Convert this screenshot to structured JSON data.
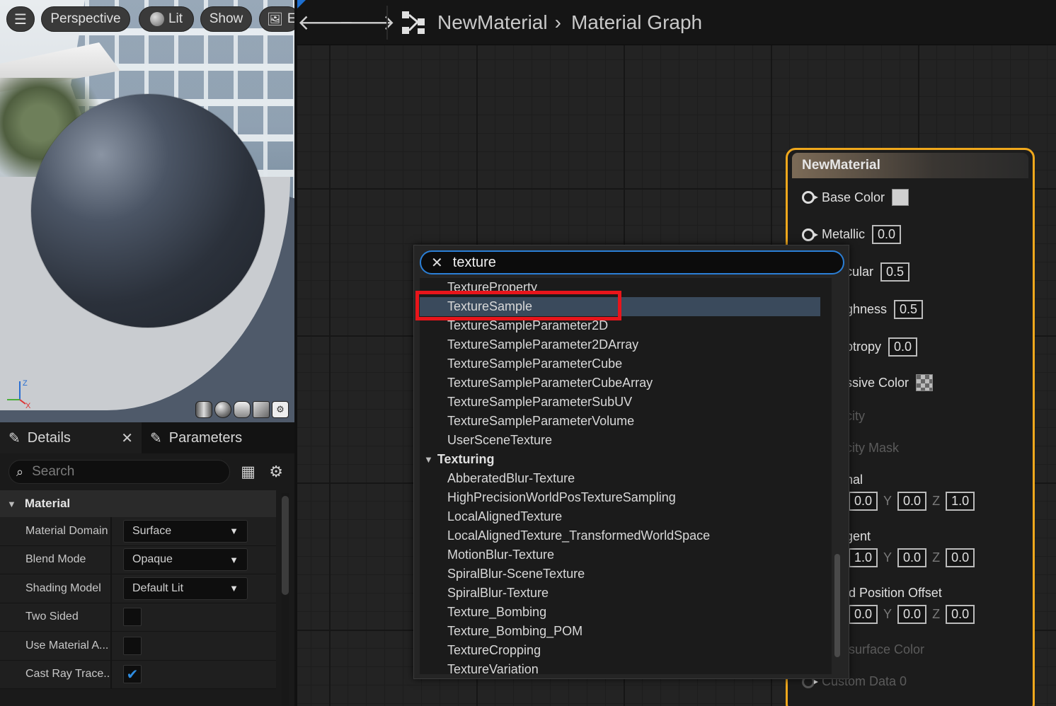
{
  "viewport": {
    "buttons": {
      "perspective": "Perspective",
      "lit": "Lit",
      "show": "Show",
      "image_partial": "E"
    },
    "axis": {
      "z": "Z",
      "x": "X"
    }
  },
  "details": {
    "tabs": {
      "details": "Details",
      "parameters": "Parameters"
    },
    "search_placeholder": "Search",
    "category": "Material",
    "rows": [
      {
        "label": "Material Domain",
        "value": "Surface",
        "type": "dropdown"
      },
      {
        "label": "Blend Mode",
        "value": "Opaque",
        "type": "dropdown"
      },
      {
        "label": "Shading Model",
        "value": "Default Lit",
        "type": "dropdown"
      },
      {
        "label": "Two Sided",
        "checked": false,
        "type": "checkbox"
      },
      {
        "label": "Use Material A...",
        "checked": false,
        "type": "checkbox"
      },
      {
        "label": "Cast Ray Trace...",
        "checked": true,
        "type": "checkbox"
      }
    ]
  },
  "graph": {
    "breadcrumb": {
      "asset": "NewMaterial",
      "graph": "Material Graph"
    },
    "node": {
      "title": "NewMaterial",
      "base_color": "Base Color",
      "metallic": "Metallic",
      "metallic_value": "0.0",
      "specular_partial": "cular",
      "specular_value": "0.5",
      "roughness_partial": "ghness",
      "roughness_value": "0.5",
      "anisotropy_partial": "otropy",
      "anisotropy_value": "0.0",
      "emissive_partial": "ssive Color",
      "opacity_partial": "city",
      "opacity_mask_partial": "city Mask",
      "normal_partial": "nal",
      "normal_values": {
        "x": "0.0",
        "y": "0.0",
        "z": "1.0"
      },
      "tangent_partial": "gent",
      "tangent_values": {
        "x": "1.0",
        "y": "0.0",
        "z": "0.0"
      },
      "wpo_partial": "d Position Offset",
      "wpo_values": {
        "x": "0.0",
        "y": "0.0",
        "z": "0.0"
      },
      "subsurface_partial": "surface Color",
      "custom_data": "Custom Data 0",
      "axis_labels": {
        "y": "Y",
        "z": "Z"
      }
    }
  },
  "context_menu": {
    "search_value": "texture",
    "items": [
      "TextureProperty",
      "TextureSample",
      "TextureSampleParameter2D",
      "TextureSampleParameter2DArray",
      "TextureSampleParameterCube",
      "TextureSampleParameterCubeArray",
      "TextureSampleParameterSubUV",
      "TextureSampleParameterVolume",
      "UserSceneTexture"
    ],
    "selected_index": 1,
    "category": "Texturing",
    "category_items": [
      "AbberatedBlur-Texture",
      "HighPrecisionWorldPosTextureSampling",
      "LocalAlignedTexture",
      "LocalAlignedTexture_TransformedWorldSpace",
      "MotionBlur-Texture",
      "SpiralBlur-SceneTexture",
      "SpiralBlur-Texture",
      "Texture_Bombing",
      "Texture_Bombing_POM",
      "TextureCropping",
      "TextureVariation"
    ]
  },
  "colors": {
    "accent_blue": "#2b7fd6",
    "node_border": "#f0a81c",
    "highlight_red": "#e8151b",
    "selection": "#3a4a5c"
  }
}
